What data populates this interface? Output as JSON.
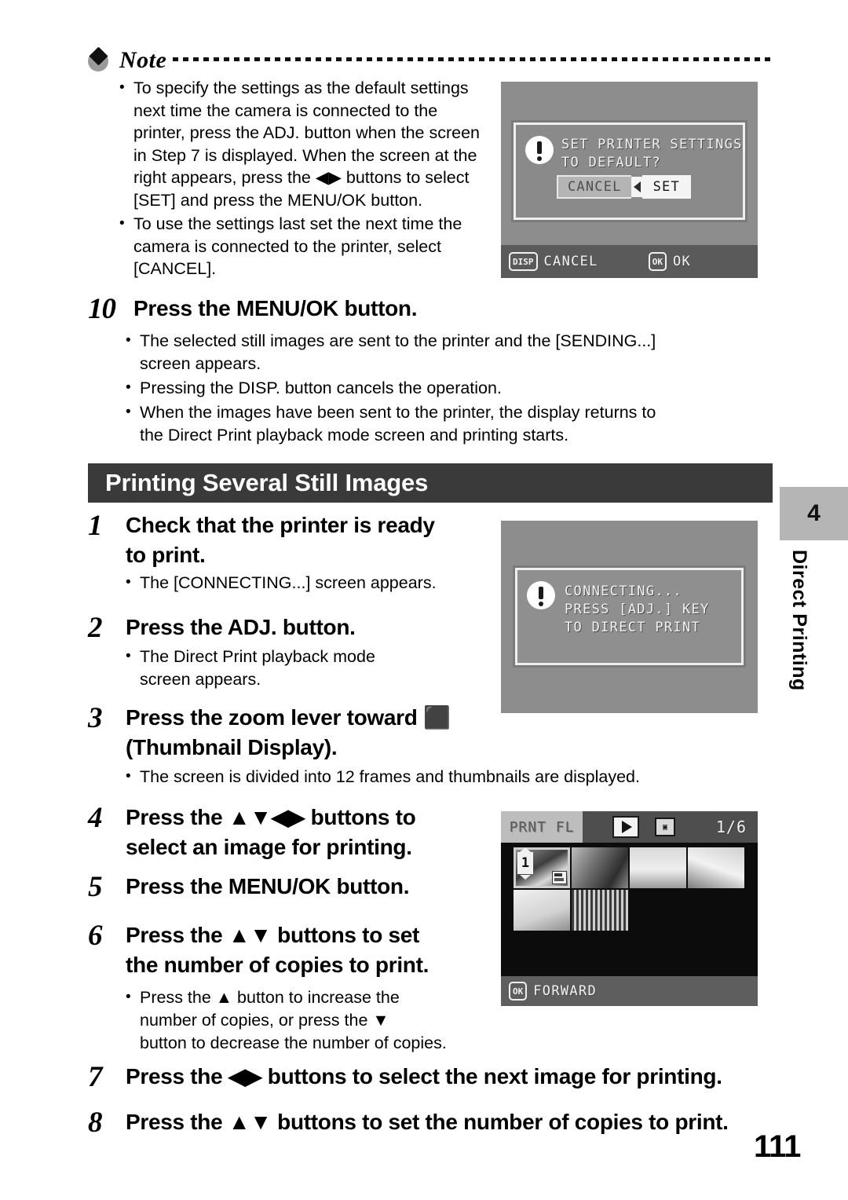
{
  "note": {
    "title": "Note",
    "icon": "note-diamond-icon",
    "bullets": [
      "To specify the settings as the default settings next time the camera is connected to the printer, press the ADJ. button when the screen in Step 7 is displayed. When the screen at the right appears, press the ◀▶ buttons to select [SET] and press the MENU/OK button.",
      "To use the settings last set the next time the camera is connected to the printer, select [CANCEL]."
    ],
    "bullet1_lines": [
      "To specify the settings as the default settings",
      "next time the camera is connected to the",
      "printer, press the ADJ. button when the screen",
      "in Step 7 is displayed. When the screen at the",
      "right appears, press the ◀▶ buttons to select",
      "[SET] and press the MENU/OK button."
    ],
    "bullet2_lines": [
      "To use the settings last set the next time the",
      "camera is connected to the printer, select",
      "[CANCEL]."
    ]
  },
  "screen_set_default": {
    "name": "set-printer-settings-dialog",
    "message_line1": "SET PRINTER SETTINGS",
    "message_line2": "TO DEFAULT?",
    "button_cancel": "CANCEL",
    "button_set": "SET",
    "bar_left_badge": "DISP",
    "bar_left_label": "CANCEL",
    "bar_right_badge": "OK",
    "bar_right_label": "OK",
    "alert_icon": "exclamation-icon"
  },
  "step10": {
    "number": "10",
    "heading": "Press the MENU/OK button.",
    "bullets": [
      [
        "The selected still images are sent to the printer and the [SENDING...]",
        "screen appears."
      ],
      [
        "Pressing the DISP. button cancels the operation."
      ],
      [
        "When the images have been sent to the printer, the display returns to",
        "the Direct Print playback mode screen and printing starts."
      ]
    ]
  },
  "section": {
    "title": "Printing Several Still Images",
    "bar_color": "#3a3a3a"
  },
  "steps": [
    {
      "number": "1",
      "heading_lines": [
        "Check that the printer is ready",
        "to print."
      ],
      "bullets": [
        [
          "The [CONNECTING...] screen appears."
        ]
      ]
    },
    {
      "number": "2",
      "heading_lines": [
        "Press the ADJ. button."
      ],
      "bullets": [
        [
          "The Direct Print playback mode",
          "screen appears."
        ]
      ]
    },
    {
      "number": "3",
      "heading_lines": [
        "Press the zoom lever toward ⬛",
        "(Thumbnail Display)."
      ],
      "bullets": [
        [
          "The screen is divided into 12 frames and thumbnails are displayed."
        ]
      ]
    },
    {
      "number": "4",
      "heading_lines": [
        "Press the ▲▼◀▶ buttons to",
        "select an image for printing."
      ],
      "bullets": []
    },
    {
      "number": "5",
      "heading_lines": [
        "Press the MENU/OK button."
      ],
      "bullets": []
    },
    {
      "number": "6",
      "heading_lines": [
        "Press the ▲▼ buttons to set",
        "the number of copies to print."
      ],
      "bullets": [
        [
          "Press the ▲ button to increase the",
          "number of copies, or press the ▼",
          "button to decrease the number of copies."
        ]
      ]
    },
    {
      "number": "7",
      "heading_lines": [
        "Press the ◀▶ buttons to select the next image for printing."
      ],
      "bullets": []
    },
    {
      "number": "8",
      "heading_lines": [
        "Press the ▲▼ buttons to set the number of copies to print."
      ],
      "bullets": []
    }
  ],
  "screen_connecting": {
    "name": "connecting-dialog",
    "line1": "CONNECTING...",
    "line2": "PRESS [ADJ.] KEY",
    "line3": "TO DIRECT PRINT",
    "alert_icon": "exclamation-icon"
  },
  "screen_thumbnails": {
    "name": "thumbnail-playback-screen",
    "mode_label": "PRNT FL",
    "play_icon": "play-icon",
    "card_icon": "direct-print-icon",
    "counter": "1/6",
    "bottom_badge": "OK",
    "bottom_label": "FORWARD",
    "selected_index": 0,
    "copies_on_selected": "1",
    "thumbnails": [
      {
        "alt": "people-photo",
        "selected": true
      },
      {
        "alt": "runner-photo",
        "selected": false
      },
      {
        "alt": "landscape-photo",
        "selected": false
      },
      {
        "alt": "portrait-photo",
        "selected": false
      },
      {
        "alt": "flowers-photo",
        "selected": false
      },
      {
        "alt": "building-photo",
        "selected": false
      }
    ]
  },
  "side_tab": {
    "chapter_number": "4",
    "chapter_title": "Direct Printing"
  },
  "page_number": "111"
}
